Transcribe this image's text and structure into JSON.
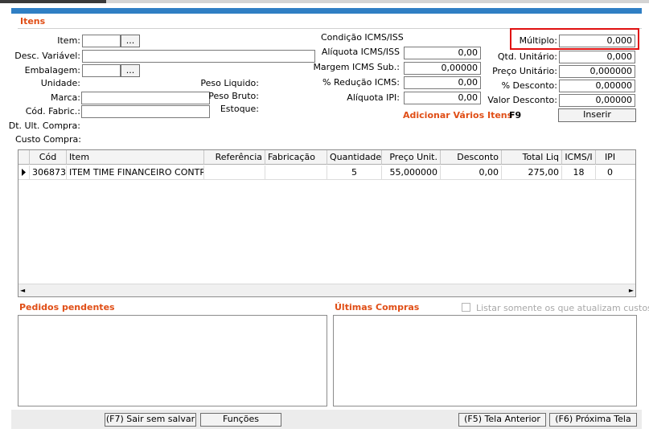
{
  "section_itens": "Itens",
  "left": {
    "item_label": "Item:",
    "desc_variavel_label": "Desc. Variável:",
    "embalagem_label": "Embalagem:",
    "unidade_label": "Unidade:",
    "marca_label": "Marca:",
    "cod_fabric_label": "Cód. Fabric.:",
    "dt_ult_compra_label": "Dt. Ult. Compra:",
    "custo_compra_label": "Custo Compra:",
    "lookup_button": "...",
    "peso_liquido_label": "Peso Liquido:",
    "peso_bruto_label": "Peso Bruto:",
    "estoque_label": "Estoque:"
  },
  "middle": {
    "condicao_label": "Condição ICMS/ISS",
    "aliquota_icms_label": "Alíquota ICMS/ISS",
    "aliquota_icms_value": "0,00",
    "margem_label": "Margem ICMS Sub.:",
    "margem_value": "0,00000",
    "reducao_label": "% Redução ICMS:",
    "reducao_value": "0,00",
    "aliquota_ipi_label": "Alíquota IPI:",
    "aliquota_ipi_value": "0,00",
    "adicionar_label": "Adicionar Vários Itens",
    "f9_label": "F9"
  },
  "right": {
    "multiplo_label": "Múltiplo:",
    "multiplo_value": "0,000",
    "qtd_label": "Qtd. Unitário:",
    "qtd_value": "0,000",
    "preco_label": "Preço Unitário:",
    "preco_value": "0,000000",
    "desconto_label": "% Desconto:",
    "desconto_value": "0,00000",
    "valor_desconto_label": "Valor Desconto:",
    "valor_desconto_value": "0,00000",
    "inserir_button": "Inserir"
  },
  "grid": {
    "columns": [
      "Cód",
      "Item",
      "Referência",
      "Fabricação",
      "Quantidade",
      "Preço Unit.",
      "Desconto",
      "Total Liq",
      "ICMS/I",
      "IPI"
    ],
    "rows": [
      [
        "306873",
        "ITEM TIME FINANCEIRO CONTR",
        "",
        "",
        "5",
        "55,000000",
        "0,00",
        "275,00",
        "18",
        "0"
      ]
    ],
    "scroll_left": "◄",
    "scroll_right": "►"
  },
  "bottom": {
    "pedidos_label": "Pedidos pendentes",
    "ultimas_label": "Últimas Compras",
    "listar_label": "Listar somente os que atualizam custos?"
  },
  "footer": {
    "sair_button": "(F7) Sair sem salvar",
    "funcoes_button": "Funções",
    "tela_anterior_button": "(F5) Tela Anterior",
    "proxima_tela_button": "(F6) Próxima Tela"
  },
  "colors": {
    "accent": "#e04e16",
    "top_bar": "#2f7fc4",
    "highlight": "#e01010"
  }
}
